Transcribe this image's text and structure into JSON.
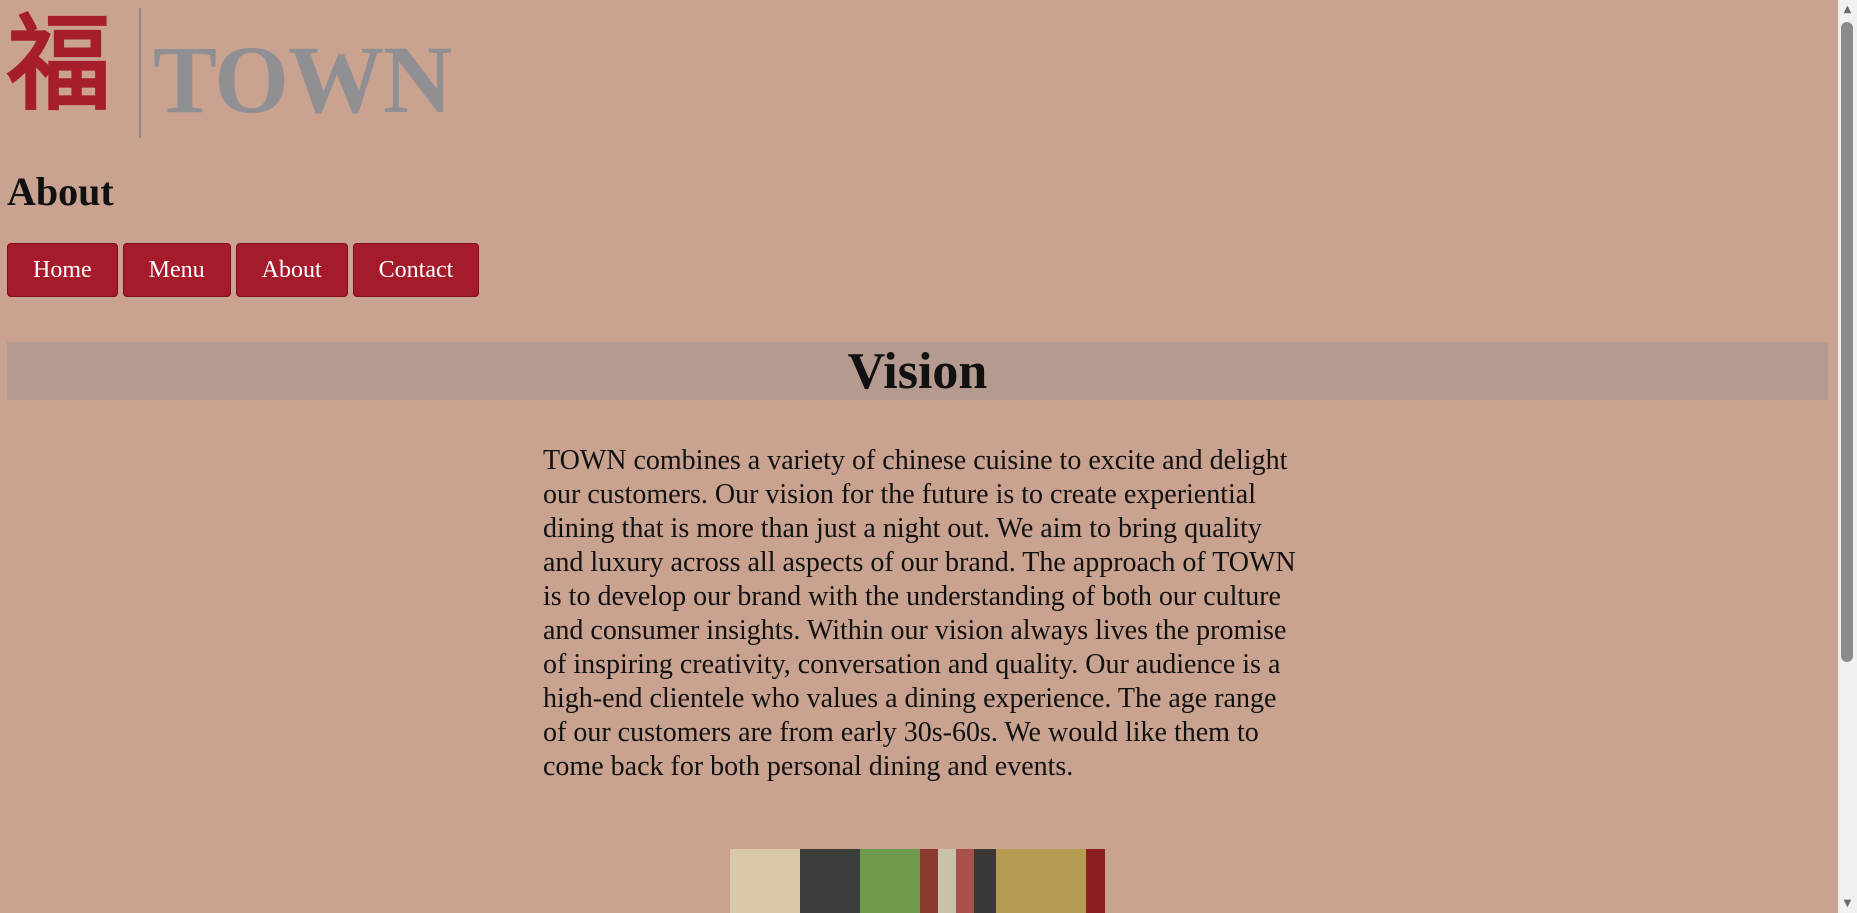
{
  "logo": {
    "char": "福",
    "word": "TOWN"
  },
  "page": {
    "heading": "About"
  },
  "nav": [
    {
      "label": "Home"
    },
    {
      "label": "Menu"
    },
    {
      "label": "About"
    },
    {
      "label": "Contact"
    }
  ],
  "vision": {
    "title": "Vision",
    "text": "TOWN combines a variety of chinese cuisine to excite and delight our customers. Our vision for the future is to create experiential dining that is more than just a night out. We aim to bring quality and luxury across all aspects of our brand. The approach of TOWN is to develop our brand with the understanding of both our culture and consumer insights. Within our vision always lives the promise of inspiring creativity, conversation and quality. Our audience is a high-end clientele who values a dining experience. The age range of our customers are from early 30s-60s. We would like them to come back for both personal dining and events."
  },
  "colors": {
    "background": "#c9a290",
    "button": "#a51b2b",
    "logo_red": "#a61e2c",
    "logo_gray": "#8f8f94",
    "vision_bar": "#b59a8f"
  }
}
